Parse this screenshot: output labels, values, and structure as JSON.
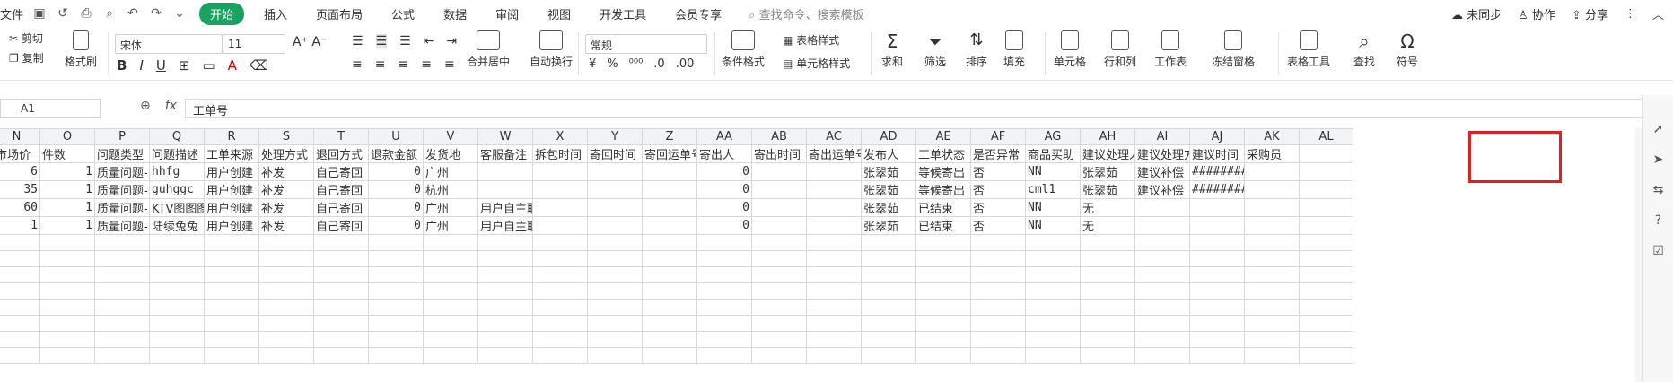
{
  "tabbar": {
    "file_label": "文件",
    "menus": [
      "开始",
      "插入",
      "页面布局",
      "公式",
      "数据",
      "审阅",
      "视图",
      "开发工具",
      "会员专享"
    ],
    "search_placeholder": "查找命令、搜索模板",
    "right": [
      "未同步",
      "协作",
      "分享"
    ]
  },
  "ribbon": {
    "cut": "剪切",
    "copy": "复制",
    "format_painter": "格式刷",
    "font_name": "宋体",
    "font_size": "11",
    "merge_center": "合并居中",
    "wrap": "自动换行",
    "number_format": "常规",
    "table_style": "表格样式",
    "cell_style": "单元格样式",
    "cond_format": "条件格式",
    "sum": "求和",
    "filter": "筛选",
    "sort": "排序",
    "fill": "填充",
    "cell": "单元格",
    "row_col": "行和列",
    "sheet": "工作表",
    "freeze": "冻结窗格",
    "table_tools": "表格工具",
    "find": "查找",
    "symbol": "符号"
  },
  "formula_bar": {
    "cell_ref": "A1",
    "fx": "fx",
    "value": "工单号"
  },
  "sheet": {
    "columns": [
      "N",
      "O",
      "P",
      "Q",
      "R",
      "S",
      "T",
      "U",
      "V",
      "W",
      "X",
      "Y",
      "Z",
      "AA",
      "AB",
      "AC",
      "AD",
      "AE",
      "AF",
      "AG",
      "AH",
      "AI",
      "AJ",
      "AK",
      "AL"
    ],
    "header_row": [
      "市场价",
      "件数",
      "问题类型",
      "问题描述",
      "工单来源",
      "处理方式",
      "退回方式",
      "退款金额",
      "发货地",
      "客服备注",
      "拆包时间",
      "寄回时间",
      "寄回运单号",
      "寄出人",
      "寄出时间",
      "寄出运单号",
      "发布人",
      "工单状态",
      "是否异常",
      "商品买助",
      "建议处理人",
      "建议处理方",
      "建议时间",
      "采购员",
      ""
    ],
    "rows": [
      [
        "6",
        "1",
        "质量问题-",
        "hhfg",
        "用户创建",
        "补发",
        "自己寄回",
        "0",
        "广州",
        "",
        "",
        "",
        "",
        "0",
        "",
        "",
        "张翠茹",
        "等候寄出",
        "否",
        "NN",
        "张翠茹",
        "建议补偿",
        "########",
        "",
        ""
      ],
      [
        "35",
        "1",
        "质量问题-",
        "guhggc",
        "用户创建",
        "补发",
        "自己寄回",
        "0",
        "杭州",
        "",
        "",
        "",
        "",
        "0",
        "",
        "",
        "张翠茹",
        "等候寄出",
        "否",
        "cml1",
        "张翠茹",
        "建议补偿",
        "########",
        "",
        ""
      ],
      [
        "60",
        "1",
        "质量问题-",
        "KTV图图图",
        "用户创建",
        "补发",
        "自己寄回",
        "0",
        "广州",
        "用户自主取消申请",
        "",
        "",
        "",
        "0",
        "",
        "",
        "张翠茹",
        "已结束",
        "否",
        "NN",
        "无",
        "",
        "",
        "",
        ""
      ],
      [
        "1",
        "1",
        "质量问题-",
        "陆续兔兔",
        "用户创建",
        "补发",
        "自己寄回",
        "0",
        "广州",
        "用户自主取消申请",
        "",
        "",
        "",
        "0",
        "",
        "",
        "张翠茹",
        "已结束",
        "否",
        "NN",
        "无",
        "",
        "",
        "",
        ""
      ]
    ]
  },
  "colors": {
    "accent": "#1aa260",
    "highlight": "#e02020"
  }
}
